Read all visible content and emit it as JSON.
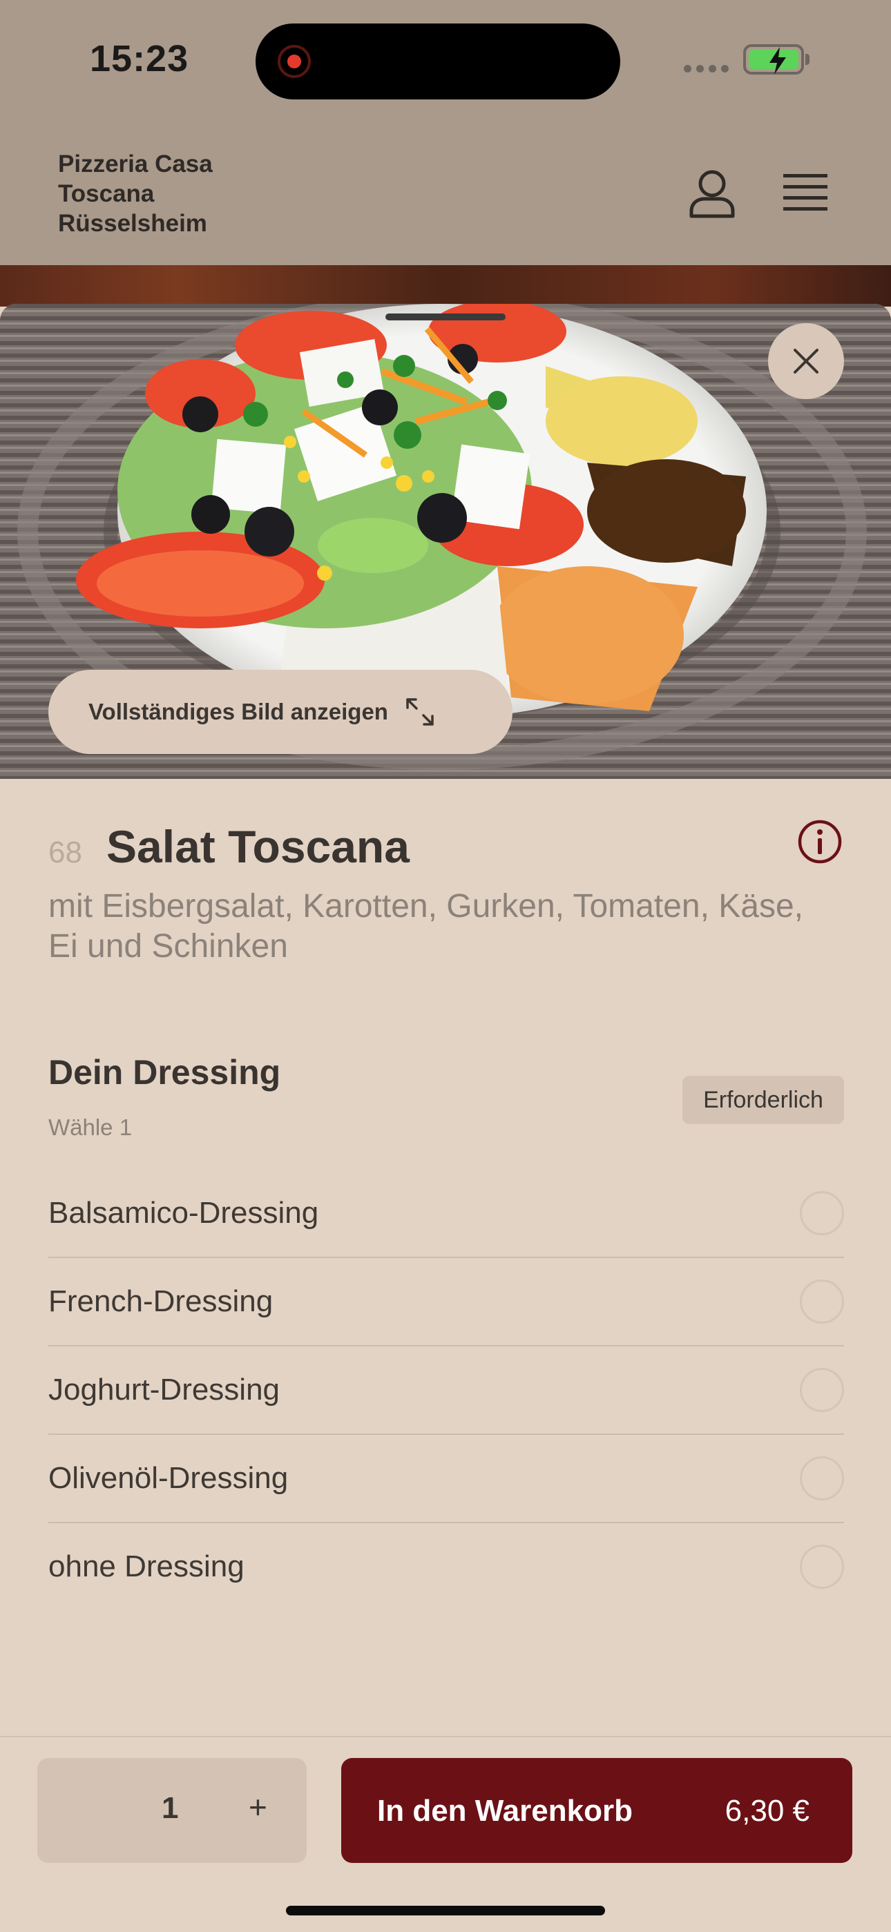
{
  "status_bar": {
    "time": "15:23"
  },
  "header": {
    "brand": "Pizzeria Casa Toscana Rüsselsheim"
  },
  "photo": {
    "full_image_label": "Vollständiges Bild anzeigen"
  },
  "item": {
    "number": "68",
    "title": "Salat Toscana",
    "description": "mit Eisbergsalat, Karotten, Gurken, Tomaten, Käse, Ei und Schinken"
  },
  "options_group": {
    "title": "Dein Dressing",
    "subtitle": "Wähle 1",
    "required_label": "Erforderlich",
    "options": [
      {
        "label": "Balsamico-Dressing",
        "selected": false
      },
      {
        "label": "French-Dressing",
        "selected": false
      },
      {
        "label": "Joghurt-Dressing",
        "selected": false
      },
      {
        "label": "Olivenöl-Dressing",
        "selected": false
      },
      {
        "label": "ohne Dressing",
        "selected": false
      }
    ]
  },
  "footer": {
    "quantity": "1",
    "plus_label": "+",
    "add_to_cart_label": "In den Warenkorb",
    "price": "6,30 €"
  },
  "colors": {
    "accent": "#6b1116",
    "background": "#e2d3c4",
    "header": "#a99a8c"
  },
  "icons": [
    "user-icon",
    "menu-icon",
    "close-icon",
    "expand-icon",
    "info-icon",
    "battery-charging-icon"
  ]
}
